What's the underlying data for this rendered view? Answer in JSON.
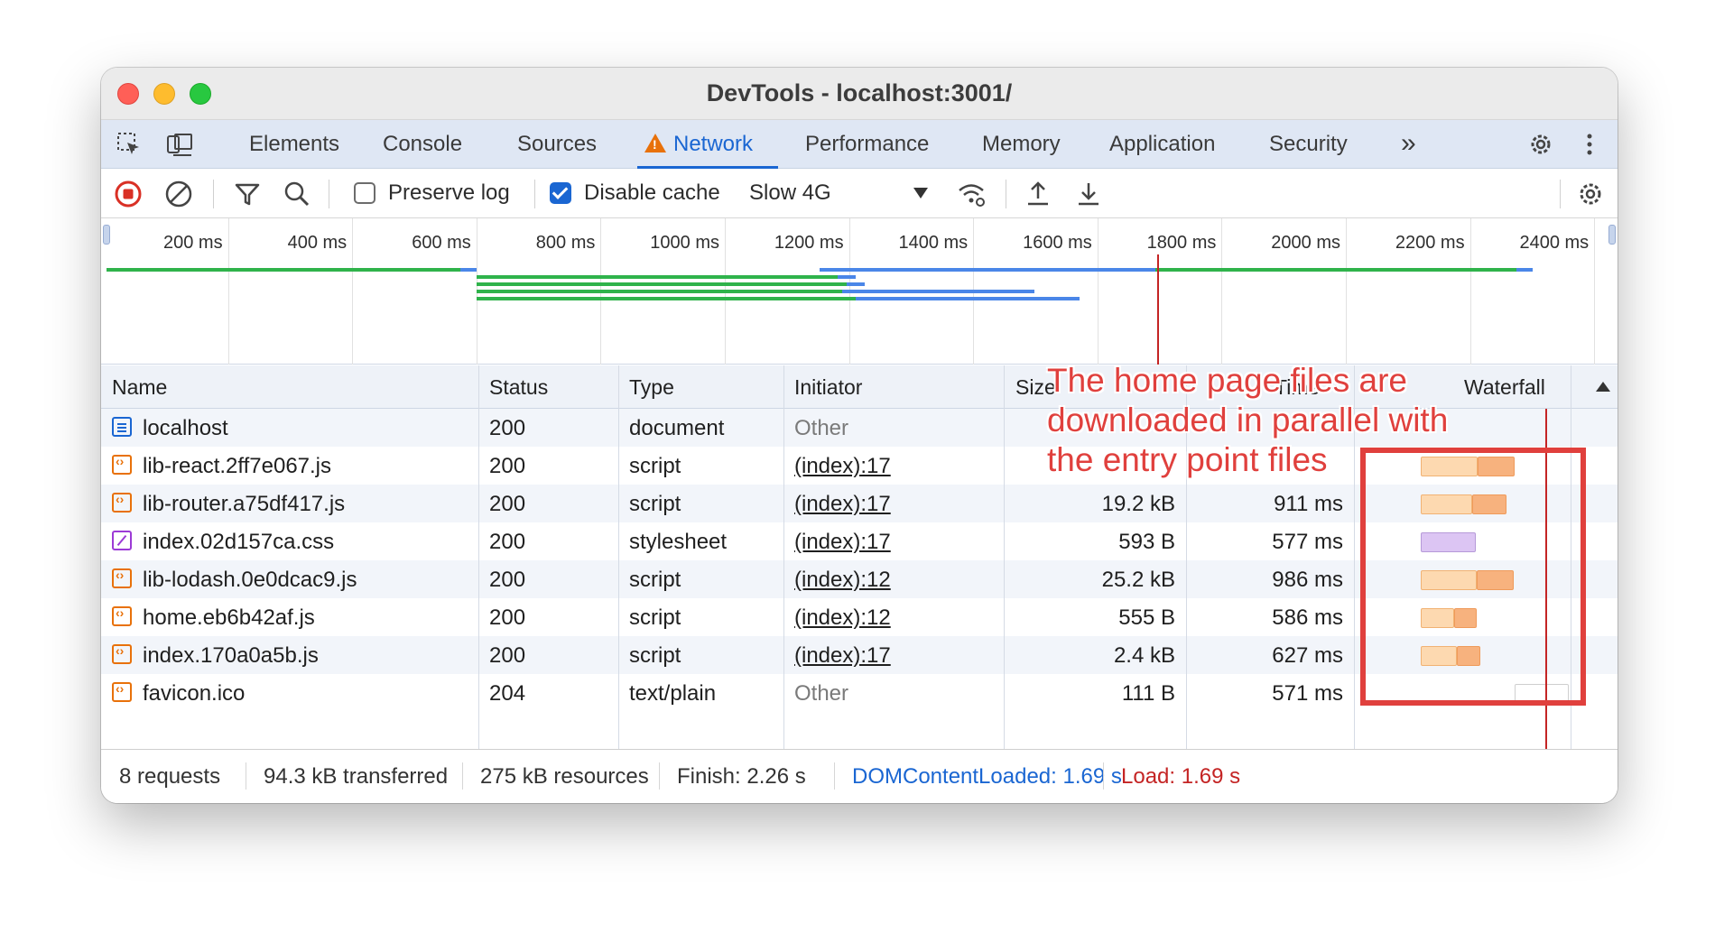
{
  "window": {
    "title": "DevTools - localhost:3001/"
  },
  "tabs": {
    "items": [
      "Elements",
      "Console",
      "Sources",
      "Network",
      "Performance",
      "Memory",
      "Application",
      "Security"
    ],
    "active": "Network",
    "more": "»"
  },
  "toolbar": {
    "preserve_log": "Preserve log",
    "preserve_log_checked": false,
    "disable_cache": "Disable cache",
    "disable_cache_checked": true,
    "throttling": "Slow 4G"
  },
  "overview": {
    "ticks": [
      "200 ms",
      "400 ms",
      "600 ms",
      "800 ms",
      "1000 ms",
      "1200 ms",
      "1400 ms",
      "1600 ms",
      "1800 ms",
      "2000 ms",
      "2200 ms",
      "2400 ms"
    ]
  },
  "table": {
    "headers": {
      "name": "Name",
      "status": "Status",
      "type": "Type",
      "initiator": "Initiator",
      "size": "Size",
      "time": "Time",
      "waterfall": "Waterfall"
    },
    "rows": [
      {
        "name": "localhost",
        "icon": "document-icon",
        "status": "200",
        "type": "document",
        "initiator": "Other",
        "size": "",
        "time": "",
        "waterfall_start": 0.0,
        "waterfall_end": 0.0
      },
      {
        "name": "lib-react.2ff7e067.js",
        "icon": "script-icon",
        "status": "200",
        "type": "script",
        "initiator": "(index):17",
        "size": "",
        "time": "",
        "waterfall_start": 0.69,
        "waterfall_end": 1.69
      },
      {
        "name": "lib-router.a75df417.js",
        "icon": "script-icon",
        "status": "200",
        "type": "script",
        "initiator": "(index):17",
        "size": "19.2 kB",
        "time": "911 ms",
        "waterfall_start": 0.69,
        "waterfall_end": 1.6
      },
      {
        "name": "index.02d157ca.css",
        "icon": "stylesheet-icon",
        "status": "200",
        "type": "stylesheet",
        "initiator": "(index):17",
        "size": "593 B",
        "time": "577 ms",
        "waterfall_start": 0.69,
        "waterfall_end": 1.27
      },
      {
        "name": "lib-lodash.0e0dcac9.js",
        "icon": "script-icon",
        "status": "200",
        "type": "script",
        "initiator": "(index):12",
        "size": "25.2 kB",
        "time": "986 ms",
        "waterfall_start": 0.69,
        "waterfall_end": 1.68
      },
      {
        "name": "home.eb6b42af.js",
        "icon": "script-icon",
        "status": "200",
        "type": "script",
        "initiator": "(index):12",
        "size": "555 B",
        "time": "586 ms",
        "waterfall_start": 0.69,
        "waterfall_end": 1.28
      },
      {
        "name": "index.170a0a5b.js",
        "icon": "script-icon",
        "status": "200",
        "type": "script",
        "initiator": "(index):17",
        "size": "2.4 kB",
        "time": "627 ms",
        "waterfall_start": 0.69,
        "waterfall_end": 1.32
      },
      {
        "name": "favicon.ico",
        "icon": "icon-file-icon",
        "status": "204",
        "type": "text/plain",
        "initiator": "Other",
        "size": "111 B",
        "time": "571 ms",
        "waterfall_start": 1.69,
        "waterfall_end": 2.26
      }
    ]
  },
  "annotation": {
    "text": "The home page files are downloaded in parallel with the entry point files"
  },
  "status": {
    "requests": "8 requests",
    "transferred": "94.3 kB transferred",
    "resources": "275 kB resources",
    "finish": "Finish: 2.26 s",
    "dcl": "DOMContentLoaded: 1.69 s",
    "load": "Load: 1.69 s"
  },
  "colors": {
    "accent": "#1a66d2",
    "annotation": "#e0403d",
    "load_line": "#c42424",
    "warning": "#e8710a"
  }
}
